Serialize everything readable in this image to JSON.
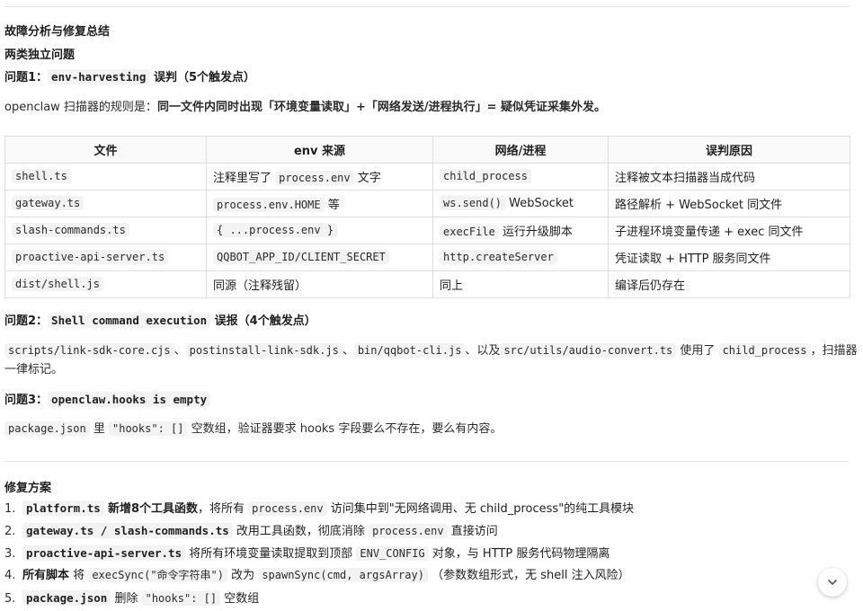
{
  "title": "故障分析与修复总结",
  "subtitle": "两类独立问题",
  "issue1": {
    "prefix": "问题1：",
    "code": "env-harvesting",
    "suffix": "误判（5个触发点）",
    "desc_plain": "openclaw 扫描器的规则是：",
    "desc_bold": "同一文件内同时出现「环境变量读取」+「网络发送/进程执行」= 疑似凭证采集外发。"
  },
  "table": {
    "headers": [
      "文件",
      "env 来源",
      "网络/进程",
      "误判原因"
    ],
    "rows": [
      {
        "file": "shell.ts",
        "env_code": "",
        "env_pre": "注释里写了 ",
        "env_c": "process.env",
        "env_post": " 文字",
        "net_c": "child_process",
        "net_post": "",
        "reason": "注释被文本扫描器当成代码"
      },
      {
        "file": "gateway.ts",
        "env_pre": "",
        "env_c": "process.env.HOME",
        "env_post": " 等",
        "net_c": "ws.send()",
        "net_post": " WebSocket",
        "reason": "路径解析 + WebSocket 同文件"
      },
      {
        "file": "slash-commands.ts",
        "env_pre": "",
        "env_c": "{ ...process.env }",
        "env_post": "",
        "net_c": "execFile",
        "net_post": " 运行升级脚本",
        "reason": "子进程环境变量传递 + exec 同文件"
      },
      {
        "file": "proactive-api-server.ts",
        "env_pre": "",
        "env_c": "QQBOT_APP_ID/CLIENT_SECRET",
        "env_post": "",
        "net_c": "http.createServer",
        "net_post": "",
        "reason": "凭证读取 + HTTP 服务同文件"
      },
      {
        "file": "dist/shell.js",
        "env_pre": "同源（注释残留）",
        "env_c": "",
        "env_post": "",
        "net_c": "",
        "net_post": "同上",
        "reason": "编译后仍存在"
      }
    ]
  },
  "issue2": {
    "prefix": "问题2：",
    "code": "Shell command execution",
    "suffix": "误报（4个触发点）",
    "f1": "scripts/link-sdk-core.cjs",
    "sep1": "、",
    "f2": "postinstall-link-sdk.js",
    "sep2": "、",
    "f3": "bin/qqbot-cli.js",
    "sep3": "、以及",
    "f4": "src/utils/audio-convert.ts",
    "mid": "使用了",
    "f5": "child_process",
    "tail": "，扫描器",
    "line2": "一律标记。"
  },
  "issue3": {
    "prefix": "问题3：",
    "code": "openclaw.hooks is empty",
    "c1": "package.json",
    "t1": "里",
    "c2": "\"hooks\": []",
    "t2": "空数组，验证器要求 hooks 字段要么不存在，要么有内容。"
  },
  "fix_title": "修复方案",
  "fixes": [
    {
      "num": "1.",
      "code": "platform.ts",
      "bold": "新增8个工具函数",
      "pre": "，将所有",
      "c2": "process.env",
      "post": "访问集中到\"无网络调用、无 child_process\"的纯工具模块"
    },
    {
      "num": "2.",
      "code": "gateway.ts / slash-commands.ts",
      "bold": "",
      "pre": "改用工具函数，彻底消除",
      "c2": "process.env",
      "post": "直接访问"
    },
    {
      "num": "3.",
      "code": "proactive-api-server.ts",
      "bold": "",
      "pre": "将所有环境变量读取提取到顶部",
      "c2": "ENV_CONFIG",
      "post": "对象，与 HTTP 服务代码物理隔离"
    },
    {
      "num": "4.",
      "code": "",
      "bold": "所有脚本",
      "pre": "将",
      "c2": "execSync(\"命令字符串\")",
      "mid": "改为",
      "c3": "spawnSync(cmd, argsArray)",
      "post": "（参数数组形式，无 shell 注入风险）"
    },
    {
      "num": "5.",
      "code": "package.json",
      "bold": "",
      "pre": "删除",
      "c2": "\"hooks\": []",
      "post": "空数组"
    }
  ]
}
